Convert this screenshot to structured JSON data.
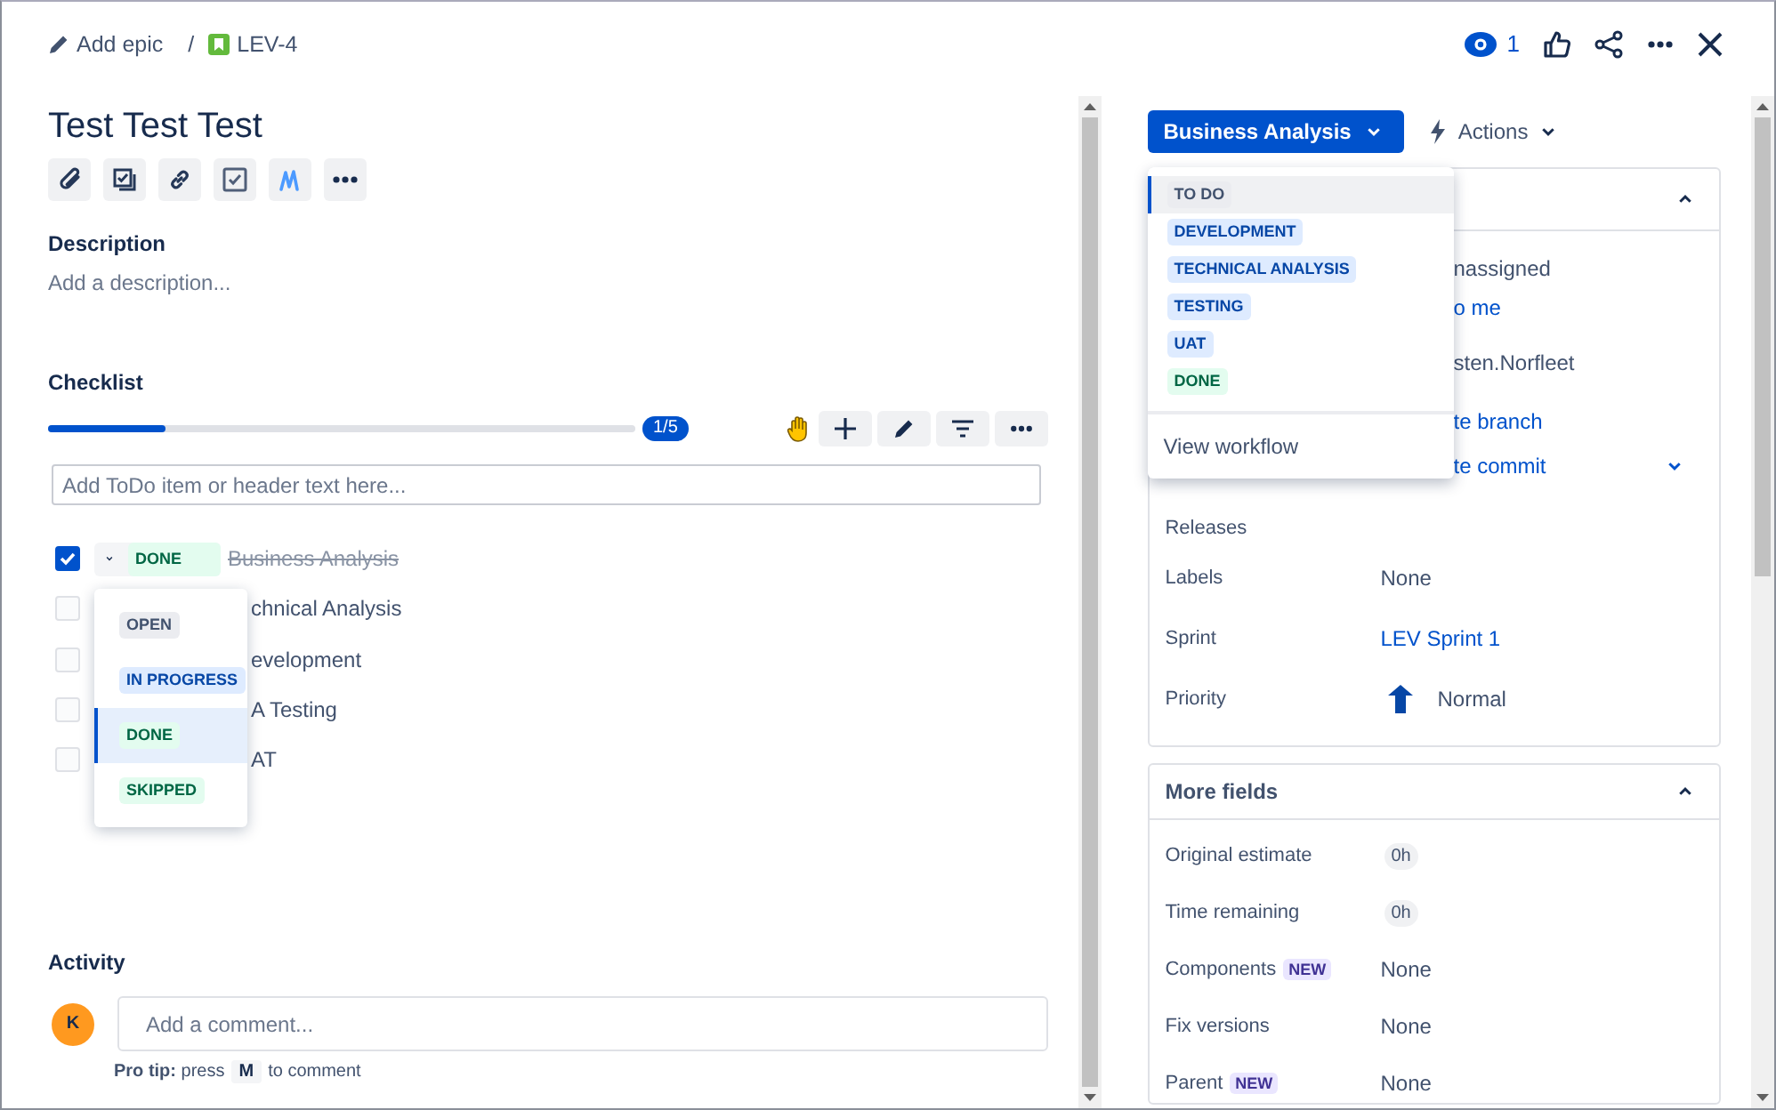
{
  "breadcrumb": {
    "epic_link": "Add epic",
    "separator": "/",
    "issue_key": "LEV-4"
  },
  "header_actions": {
    "watchers": "1"
  },
  "issue": {
    "title": "Test Test Test"
  },
  "toolbar": [
    {
      "kind": "attach"
    },
    {
      "kind": "child"
    },
    {
      "kind": "link"
    },
    {
      "kind": "checklist"
    },
    {
      "kind": "marker"
    },
    {
      "kind": "more"
    }
  ],
  "description": {
    "label": "Description",
    "placeholder": "Add a description..."
  },
  "checklist": {
    "label": "Checklist",
    "level": 0.2,
    "count": "1/5",
    "input_placeholder": "Add ToDo item or header text here...",
    "items": [
      {
        "checked": true,
        "status": {
          "label": "DONE",
          "kind": "done"
        },
        "text": "Business Analysis"
      },
      {
        "checked": false,
        "text": "chnical Analysis"
      },
      {
        "checked": false,
        "text": "evelopment"
      },
      {
        "checked": false,
        "text": "A Testing"
      },
      {
        "checked": false,
        "text": "AT"
      }
    ],
    "status_menu": [
      {
        "label": "OPEN",
        "kind": "todo",
        "selected": false
      },
      {
        "label": "IN PROGRESS",
        "kind": "progress",
        "selected": false
      },
      {
        "label": "DONE",
        "kind": "done",
        "selected": true
      },
      {
        "label": "SKIPPED",
        "kind": "done",
        "selected": false
      }
    ]
  },
  "activity": {
    "label": "Activity",
    "avatar": "K",
    "comment_placeholder": "Add a comment...",
    "tip": "**Pro tip:** press",
    "tip_key": "M",
    "tip_end": "to comment"
  },
  "status_button": {
    "label": "Business Analysis"
  },
  "actions_button": {
    "label": "Actions"
  },
  "status_dropdown": {
    "items": [
      {
        "label": "TO DO",
        "kind": "todo",
        "selected": true
      },
      {
        "label": "DEVELOPMENT",
        "kind": "progress",
        "selected": false
      },
      {
        "label": "TECHNICAL ANALYSIS",
        "kind": "progress",
        "selected": false
      },
      {
        "label": "TESTING",
        "kind": "progress",
        "selected": false
      },
      {
        "label": "UAT",
        "kind": "progress",
        "selected": false
      },
      {
        "label": "DONE",
        "kind": "done",
        "selected": false
      }
    ],
    "footer": "View workflow"
  },
  "details": {
    "fields": [
      {
        "value": "nassigned",
        "kind": "text"
      },
      {
        "value": "o me",
        "kind": "link"
      },
      {
        "value": "sten.Norfleet",
        "kind": "text"
      },
      {
        "value": "te branch",
        "kind": "link"
      },
      {
        "value": "te commit",
        "kind": "link-menu"
      },
      {
        "label": "Releases"
      },
      {
        "label": "Labels",
        "value": "None",
        "kind": "text"
      },
      {
        "label": "Sprint",
        "value": "LEV Sprint 1",
        "kind": "link"
      },
      {
        "label": "Priority",
        "value": "Normal",
        "kind": "priority"
      }
    ]
  },
  "more_fields": {
    "title": "More fields",
    "fields": [
      {
        "label": "Original estimate",
        "value": "0h",
        "kind": "chip"
      },
      {
        "label": "Time remaining",
        "value": "0h",
        "kind": "chip"
      },
      {
        "label": "Components",
        "badge": "NEW",
        "value": "None",
        "kind": "text"
      },
      {
        "label": "Fix versions",
        "value": "None",
        "kind": "text"
      },
      {
        "label": "Parent",
        "badge": "NEW",
        "value": "None",
        "kind": "text"
      }
    ]
  }
}
